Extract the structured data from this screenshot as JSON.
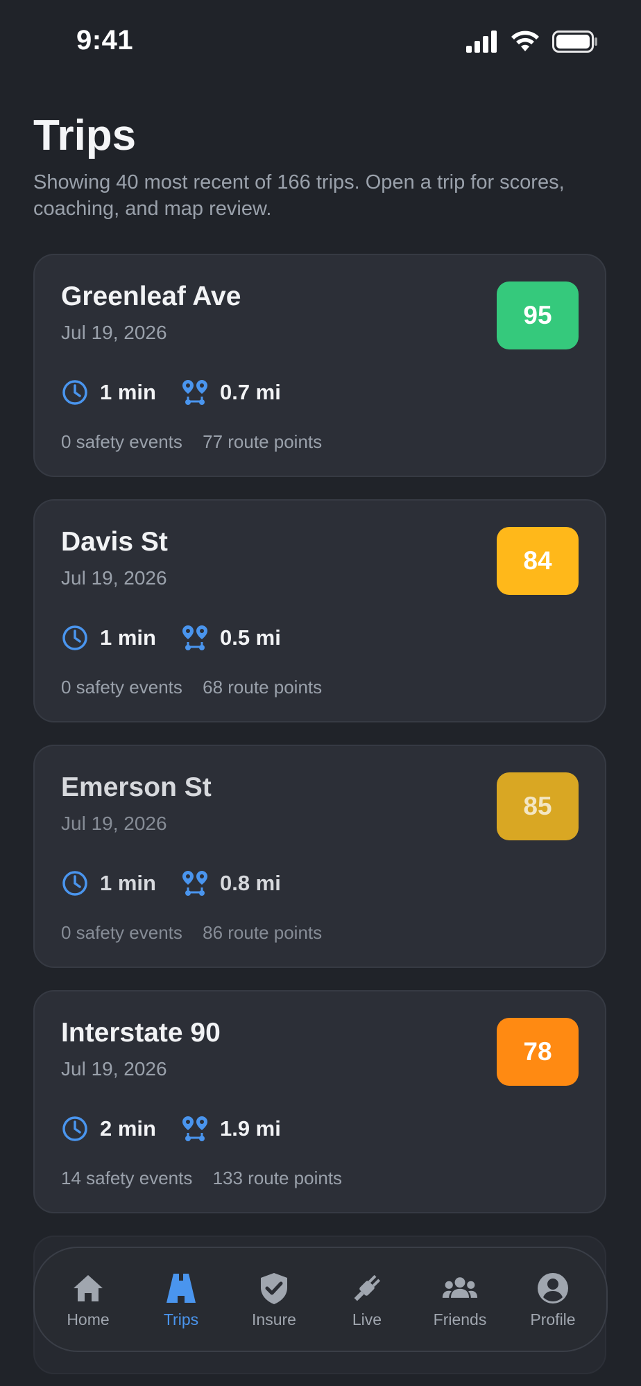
{
  "status_bar": {
    "time": "9:41"
  },
  "header": {
    "title": "Trips",
    "subtitle": "Showing 40 most recent of 166 trips. Open a trip for scores, coaching, and map review."
  },
  "trips": [
    {
      "title": "Greenleaf Ave",
      "date": "Jul 19, 2026",
      "score": "95",
      "score_color": "#35c97c",
      "duration": "1 min",
      "distance": "0.7 mi",
      "safety_events": "0 safety events",
      "route_points": "77 route points"
    },
    {
      "title": "Davis St",
      "date": "Jul 19, 2026",
      "score": "84",
      "score_color": "#ffb81a",
      "duration": "1 min",
      "distance": "0.5 mi",
      "safety_events": "0 safety events",
      "route_points": "68 route points"
    },
    {
      "title": "Emerson St",
      "date": "Jul 19, 2026",
      "score": "85",
      "score_color": "#d9a723",
      "duration": "1 min",
      "distance": "0.8 mi",
      "safety_events": "0 safety events",
      "route_points": "86 route points"
    },
    {
      "title": "Interstate 90",
      "date": "Jul 19, 2026",
      "score": "78",
      "score_color": "#ff8a12",
      "duration": "2 min",
      "distance": "1.9 mi",
      "safety_events": "14 safety events",
      "route_points": "133 route points"
    }
  ],
  "icons": {
    "duration": "clock-icon",
    "distance": "route-pins-icon"
  },
  "accent_color": "#4a95ee",
  "tabbar": {
    "active": "Trips",
    "tabs": [
      {
        "label": "Home",
        "icon": "home-icon"
      },
      {
        "label": "Trips",
        "icon": "road-icon"
      },
      {
        "label": "Insure",
        "icon": "shield-check-icon"
      },
      {
        "label": "Live",
        "icon": "plug-icon"
      },
      {
        "label": "Friends",
        "icon": "people-icon"
      },
      {
        "label": "Profile",
        "icon": "profile-icon"
      }
    ]
  }
}
